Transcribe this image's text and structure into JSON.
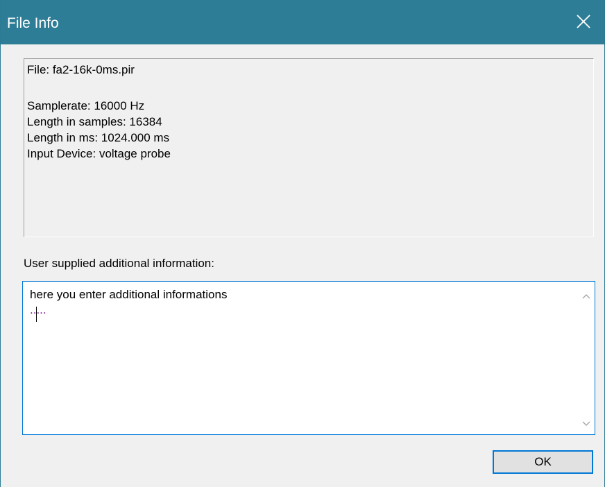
{
  "window": {
    "title": "File Info",
    "close_icon": "close-icon"
  },
  "info": {
    "file": "File: fa2-16k-0ms.pir",
    "samplerate": "Samplerate: 16000 Hz",
    "length_samples": "Length in samples: 16384",
    "length_ms": "Length in ms: 1024.000 ms",
    "input_device": "Input Device: voltage probe"
  },
  "user_info": {
    "label": "User supplied additional information:",
    "lines": [
      "here you enter additional informations",
      "....."
    ]
  },
  "buttons": {
    "ok": "OK"
  },
  "colors": {
    "titlebar": "#2e7d97",
    "focus_border": "#0078d7"
  }
}
